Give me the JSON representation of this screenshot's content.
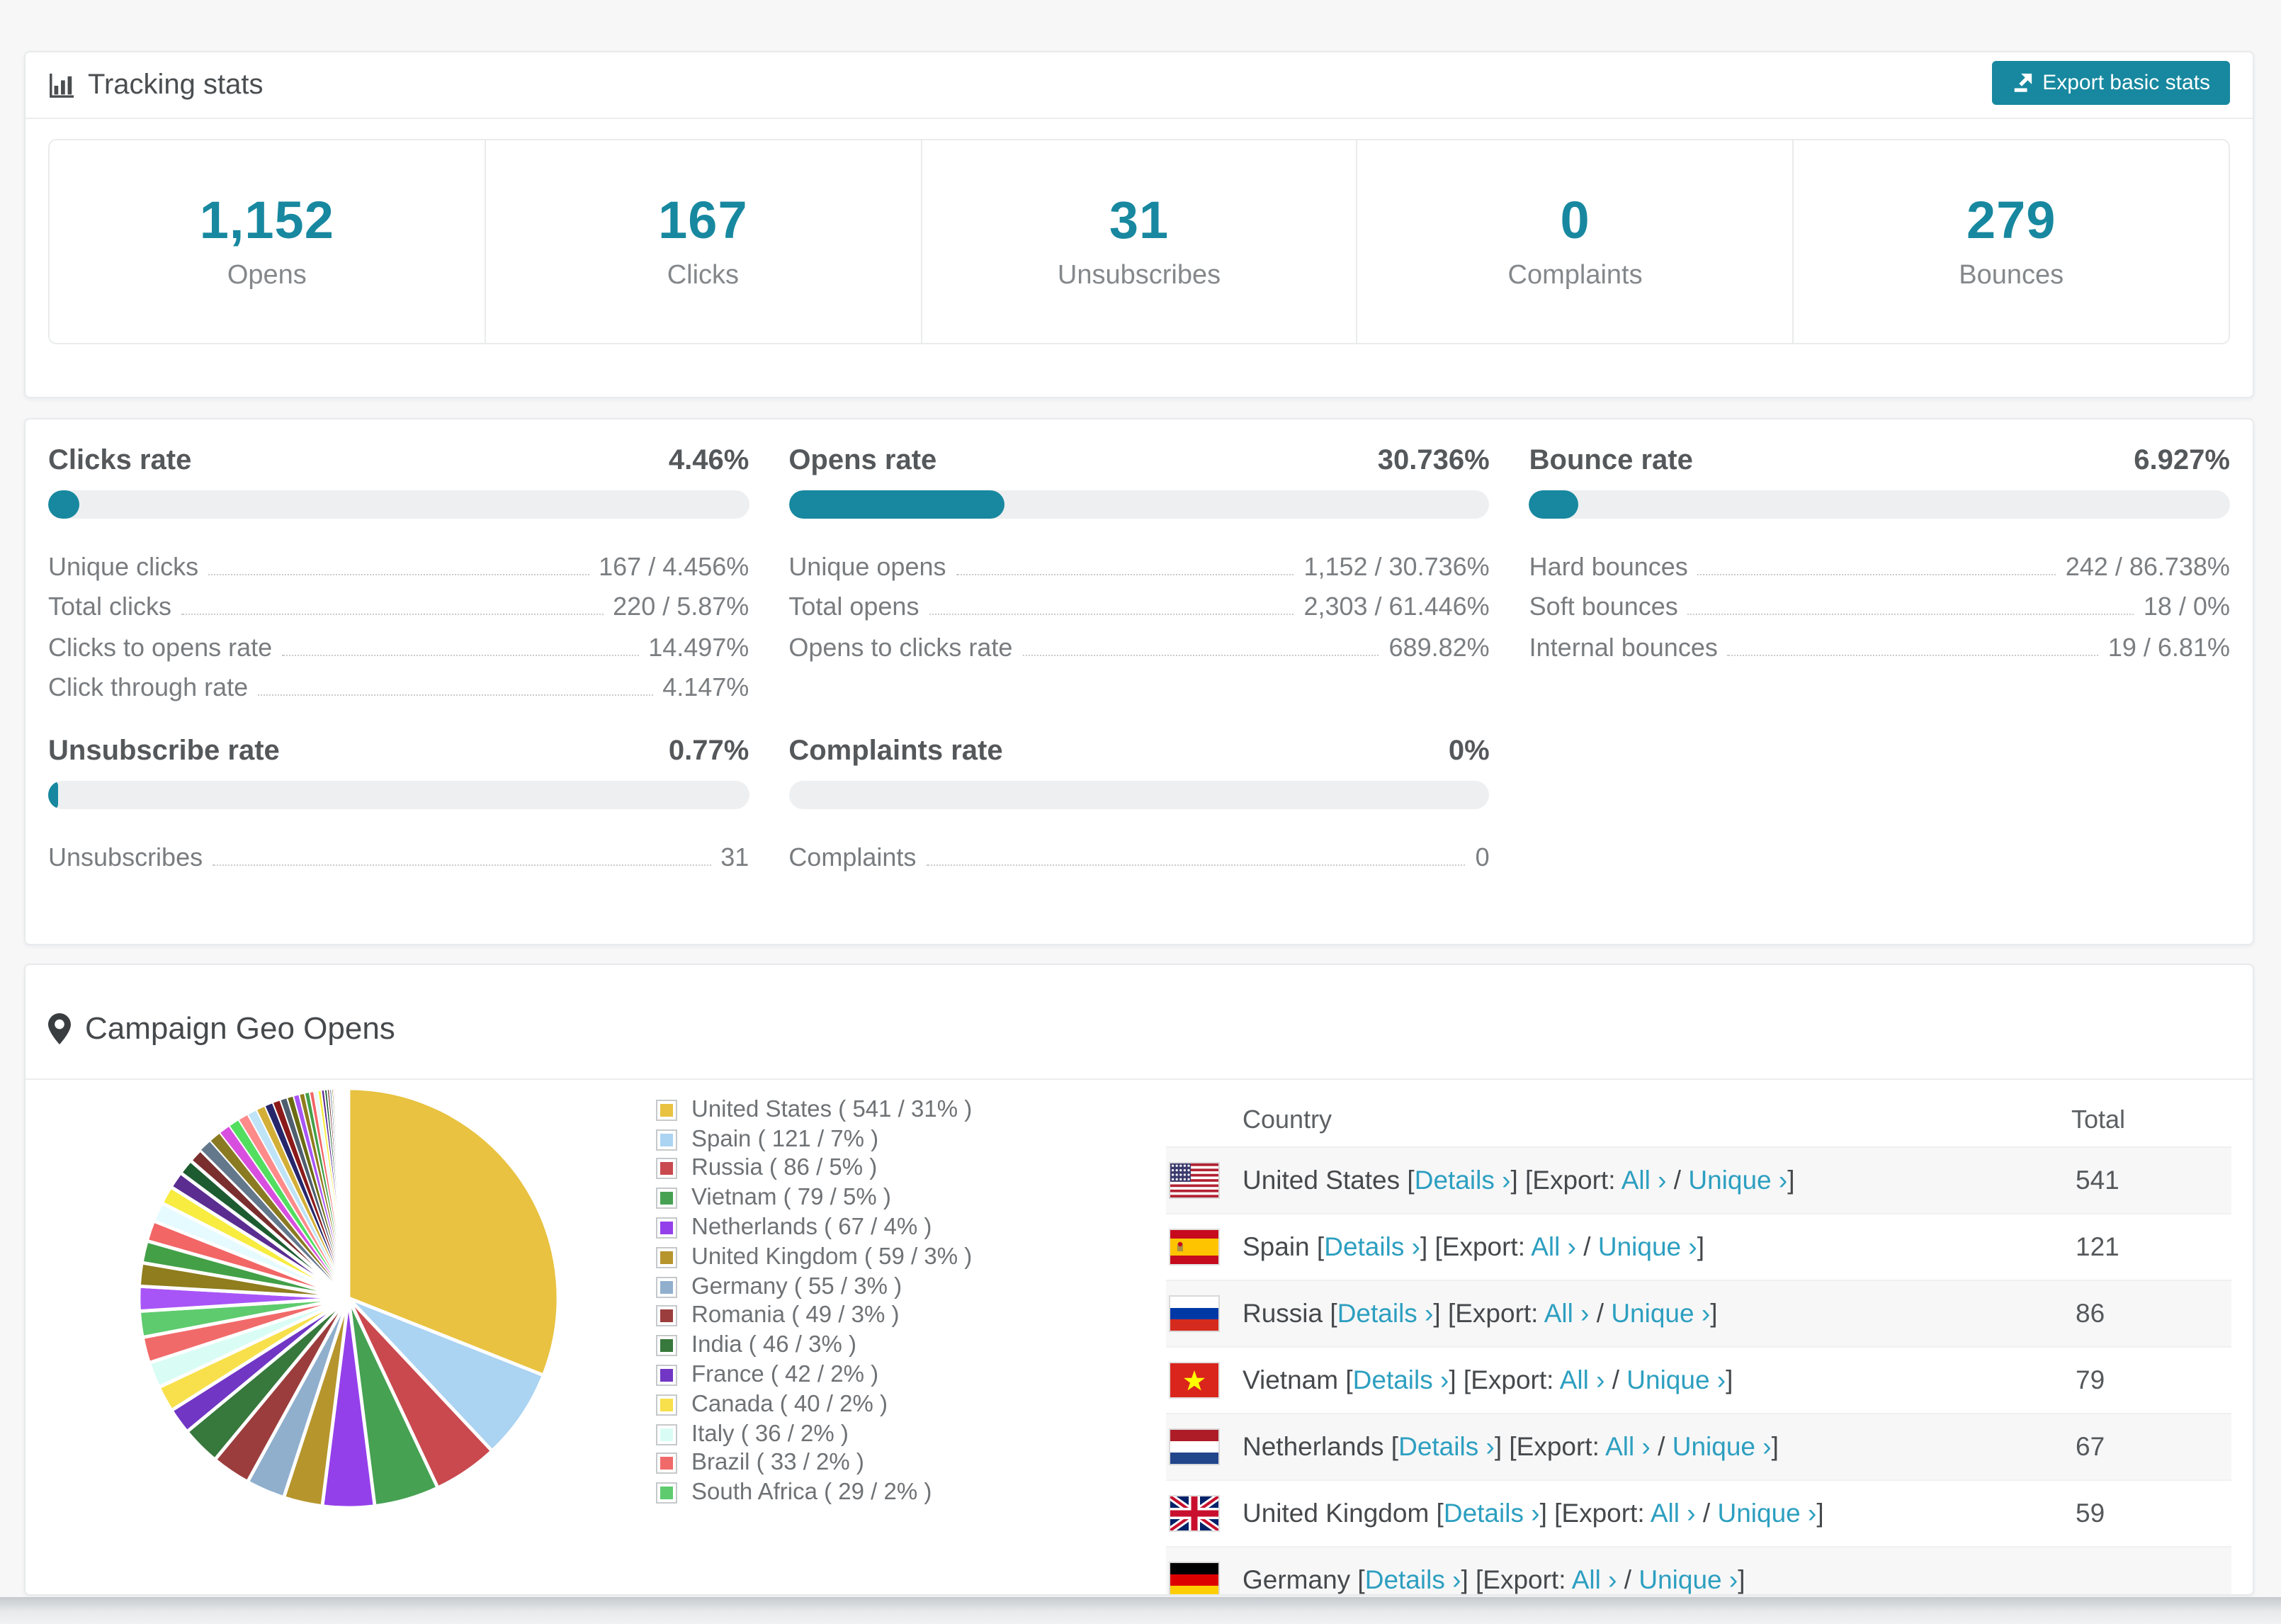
{
  "colors": {
    "accent": "#17889f",
    "link": "#2d9fc0"
  },
  "tracking": {
    "title": "Tracking stats",
    "export_label": "Export basic stats",
    "summary": [
      {
        "value": "1,152",
        "label": "Opens"
      },
      {
        "value": "167",
        "label": "Clicks"
      },
      {
        "value": "31",
        "label": "Unsubscribes"
      },
      {
        "value": "0",
        "label": "Complaints"
      },
      {
        "value": "279",
        "label": "Bounces"
      }
    ]
  },
  "rates": {
    "sections": [
      {
        "title": "Clicks rate",
        "value": "4.46%",
        "pct": 4.46,
        "rows": [
          {
            "label": "Unique clicks",
            "value": "167 / 4.456%"
          },
          {
            "label": "Total clicks",
            "value": "220 / 5.87%"
          },
          {
            "label": "Clicks to opens rate",
            "value": "14.497%"
          },
          {
            "label": "Click through rate",
            "value": "4.147%"
          }
        ]
      },
      {
        "title": "Opens rate",
        "value": "30.736%",
        "pct": 30.736,
        "rows": [
          {
            "label": "Unique opens",
            "value": "1,152 / 30.736%"
          },
          {
            "label": "Total opens",
            "value": "2,303 / 61.446%"
          },
          {
            "label": "Opens to clicks rate",
            "value": "689.82%"
          }
        ]
      },
      {
        "title": "Bounce rate",
        "value": "6.927%",
        "pct": 6.927,
        "rows": [
          {
            "label": "Hard bounces",
            "value": "242 / 86.738%"
          },
          {
            "label": "Soft bounces",
            "value": "18 / 0%"
          },
          {
            "label": "Internal bounces",
            "value": "19 / 6.81%"
          }
        ]
      },
      {
        "title": "Unsubscribe rate",
        "value": "0.77%",
        "pct": 0.77,
        "rows": [
          {
            "label": "Unsubscribes",
            "value": "31"
          }
        ]
      },
      {
        "title": "Complaints rate",
        "value": "0%",
        "pct": 0,
        "rows": [
          {
            "label": "Complaints",
            "value": "0"
          }
        ]
      }
    ]
  },
  "geo": {
    "title": "Campaign Geo Opens",
    "headers": {
      "country": "Country",
      "total": "Total"
    },
    "row_labels": {
      "open": " [",
      "details": "Details ›",
      "mid": "] [Export: ",
      "all": "All ›",
      "slash": " / ",
      "unique": "Unique ›",
      "close": "]"
    },
    "rows": [
      {
        "country": "United States",
        "flag": "us",
        "total": "541",
        "striped": true
      },
      {
        "country": "Spain",
        "flag": "es",
        "total": "121",
        "striped": false
      },
      {
        "country": "Russia",
        "flag": "ru",
        "total": "86",
        "striped": true
      },
      {
        "country": "Vietnam",
        "flag": "vn",
        "total": "79",
        "striped": false
      },
      {
        "country": "Netherlands",
        "flag": "nl",
        "total": "67",
        "striped": true
      },
      {
        "country": "United Kingdom",
        "flag": "gb",
        "total": "59",
        "striped": false
      },
      {
        "country": "Germany",
        "flag": "de",
        "total": "",
        "striped": true,
        "partial": true
      }
    ]
  },
  "chart_data": {
    "type": "pie",
    "title": "Campaign Geo Opens",
    "legend_position": "right",
    "start_angle_deg": 0,
    "direction": "clockwise",
    "series": [
      {
        "label": "United States",
        "value": 541,
        "pct": 31,
        "color": "#e8c240"
      },
      {
        "label": "Spain",
        "value": 121,
        "pct": 7,
        "color": "#abd3f2"
      },
      {
        "label": "Russia",
        "value": 86,
        "pct": 5,
        "color": "#c9494f"
      },
      {
        "label": "Vietnam",
        "value": 79,
        "pct": 5,
        "color": "#46a152"
      },
      {
        "label": "Netherlands",
        "value": 67,
        "pct": 4,
        "color": "#9440ea"
      },
      {
        "label": "United Kingdom",
        "value": 59,
        "pct": 3,
        "color": "#b6952d"
      },
      {
        "label": "Germany",
        "value": 55,
        "pct": 3,
        "color": "#8fafcd"
      },
      {
        "label": "Romania",
        "value": 49,
        "pct": 3,
        "color": "#9c3d3d"
      },
      {
        "label": "India",
        "value": 46,
        "pct": 3,
        "color": "#37783c"
      },
      {
        "label": "France",
        "value": 42,
        "pct": 2,
        "color": "#7136c4"
      },
      {
        "label": "Canada",
        "value": 40,
        "pct": 2,
        "color": "#f7e04b"
      },
      {
        "label": "Italy",
        "value": 36,
        "pct": 2,
        "color": "#d9fdf5"
      },
      {
        "label": "Brazil",
        "value": 33,
        "pct": 2,
        "color": "#f16a6a"
      },
      {
        "label": "South Africa",
        "value": 29,
        "pct": 2,
        "color": "#5ecb6e"
      }
    ],
    "others_note": "many small unlabeled slices totalling ~26%",
    "others_pcts": [
      1.9,
      1.8,
      1.7,
      1.6,
      1.5,
      1.4,
      1.3,
      1.2,
      1.1,
      1.0,
      0.95,
      0.9,
      0.85,
      0.8,
      0.75,
      0.7,
      0.65,
      0.6,
      0.55,
      0.5,
      0.46,
      0.42,
      0.38,
      0.34,
      0.3,
      0.27,
      0.24,
      0.21,
      0.18,
      0.16,
      0.14,
      0.12,
      0.1,
      0.09,
      0.08,
      0.07,
      0.06,
      0.05,
      0.04,
      0.03
    ],
    "others_palette": [
      "#a855f7",
      "#8f7d1e",
      "#43a047",
      "#f26666",
      "#e6fbff",
      "#f7ec3f",
      "#5b2d91",
      "#1d5c30",
      "#7a2e2e",
      "#64788c",
      "#8a7a22",
      "#d84fe0",
      "#52de5f",
      "#ff8a8a",
      "#bfe3f7",
      "#d4af37",
      "#26266b",
      "#8b1a1a",
      "#4f5f6f",
      "#6b6b12"
    ]
  }
}
